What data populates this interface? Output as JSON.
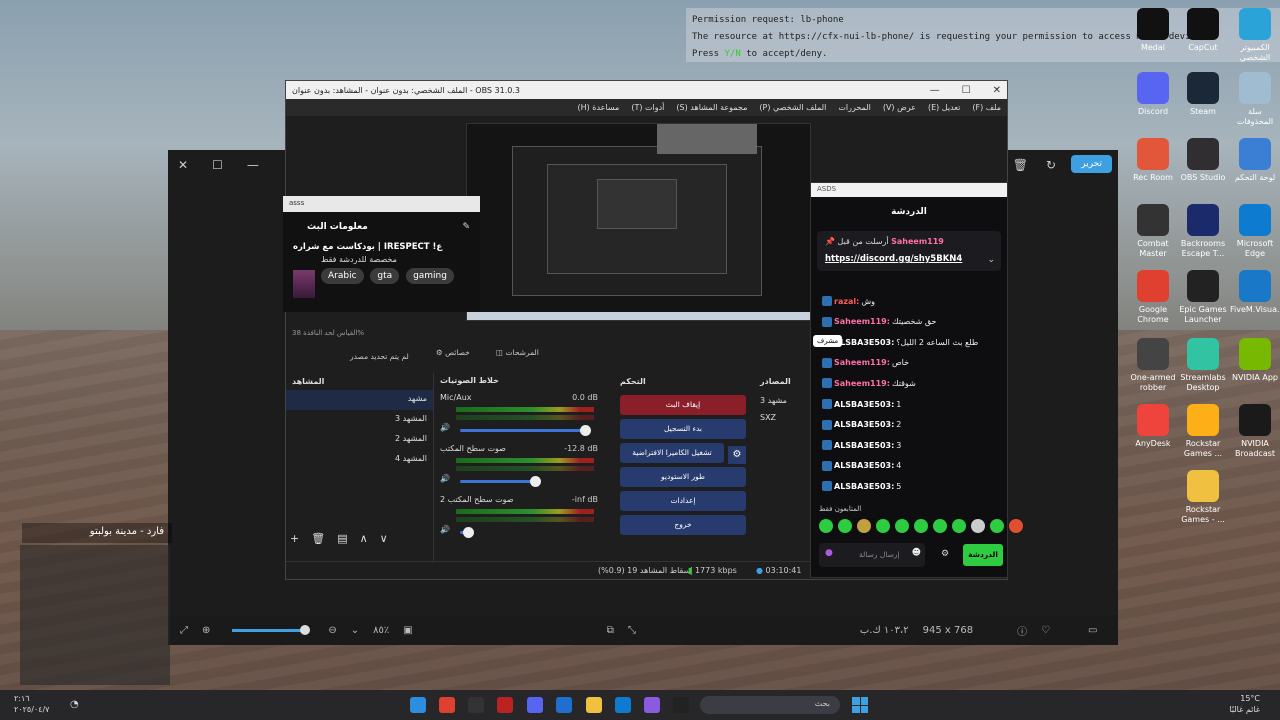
{
  "permission": {
    "line1": "Permission request: lb-phone",
    "line2": "The resource at https://cfx-nui-lb-phone/ is requesting your permission to access media devices.",
    "line3": "Press",
    "line3_key": "Y/N",
    "line3_rest": "to accept/deny."
  },
  "desktop_icons": [
    {
      "label": "Medal",
      "name": "medal-icon",
      "color": "#111111"
    },
    {
      "label": "CapCut",
      "name": "capcut-icon",
      "color": "#111111"
    },
    {
      "label": "الكمبيوتر الشخصي",
      "name": "this-pc-icon",
      "color": "#29a3d8"
    },
    {
      "label": "Discord",
      "name": "discord-icon",
      "color": "#5865f2"
    },
    {
      "label": "Steam",
      "name": "steam-icon",
      "color": "#1b2838"
    },
    {
      "label": "سلة المحذوفات",
      "name": "recycle-bin-icon",
      "color": "#9fbcd1"
    },
    {
      "label": "Rec Room",
      "name": "rec-room-icon",
      "color": "#e2573a"
    },
    {
      "label": "OBS Studio",
      "name": "obs-icon",
      "color": "#302e31"
    },
    {
      "label": "لوحة التحكم",
      "name": "control-panel-icon",
      "color": "#3a7fd4"
    },
    {
      "label": "Combat Master",
      "name": "combat-master-icon",
      "color": "#333333"
    },
    {
      "label": "Backrooms Escape T...",
      "name": "backrooms-icon",
      "color": "#1a2a6a"
    },
    {
      "label": "Microsoft Edge",
      "name": "edge-icon",
      "color": "#0c7bd0"
    },
    {
      "label": "Google Chrome",
      "name": "chrome-icon",
      "color": "#e0402f"
    },
    {
      "label": "Epic Games Launcher",
      "name": "epic-games-icon",
      "color": "#222222"
    },
    {
      "label": "FiveM.Visua...",
      "name": "fivem-visual-icon",
      "color": "#1a78c8"
    },
    {
      "label": "One-armed robber",
      "name": "one-armed-robber-icon",
      "color": "#444444"
    },
    {
      "label": "Streamlabs Desktop",
      "name": "streamlabs-icon",
      "color": "#31c3a2"
    },
    {
      "label": "NVIDIA App",
      "name": "nvidia-app-icon",
      "color": "#76b900"
    },
    {
      "label": "AnyDesk",
      "name": "anydesk-icon",
      "color": "#ef443b"
    },
    {
      "label": "Rockstar Games ...",
      "name": "rockstar-icon",
      "color": "#fcaf17"
    },
    {
      "label": "NVIDIA Broadcast",
      "name": "nvidia-broadcast-icon",
      "color": "#1a1a1a"
    },
    {
      "label": "Rockstar Games - ...",
      "name": "rockstar-folder-icon",
      "color": "#f0c040"
    }
  ],
  "photos": {
    "edit_label": "تحرير",
    "zoom": "٨٥٪",
    "dimensions": "945 x 768",
    "size": "١٠٣،٢ ك.ب"
  },
  "obs": {
    "title": "الملف الشخصي: بدون عنوان - المشاهد: بدون عنوان - OBS 31.0.3",
    "menu": [
      "ملف (F)",
      "تعديل (E)",
      "عرض (V)",
      "المحررات",
      "الملف الشخصي (P)",
      "مجموعة المشاهد (S)",
      "أدوات (T)",
      "مساعدة (H)"
    ],
    "stream_info": {
      "header": "asss",
      "title": "معلومات البث",
      "stream_title": "بودكاست مع شراره | IRESPECT !ع",
      "subtitle": "مخصصة للدردشة فقط",
      "tags": [
        "Arabic",
        "gta",
        "gaming"
      ]
    },
    "scale_label": "القياس لحد النافذة 38%",
    "no_source": "لم يتم تحديد مصدر",
    "props_label": "خصائص",
    "filters_label": "المرشحات",
    "scenes": {
      "title": "المشاهد",
      "items": [
        "مشهد",
        "المشهد 3",
        "المشهد 2",
        "المشهد 4"
      ]
    },
    "mixer": {
      "title": "خلاط الصوتيات",
      "channels": [
        {
          "name": "Mic/Aux",
          "db": "0.0 dB",
          "level": 0.92
        },
        {
          "name": "صوت سطح المكتب",
          "db": "-12.8 dB",
          "level": 0.55
        },
        {
          "name": "صوت سطح المكتب 2",
          "db": "-inf dB",
          "level": 0.05
        }
      ]
    },
    "controls": {
      "title": "التحكم",
      "buttons": [
        "إيقاف البث",
        "بدء التسجيل",
        "تشغيل الكاميرا الافتراضية",
        "طور الاستوديو",
        "إعدادات",
        "خروج"
      ]
    },
    "sources": {
      "title": "المصادر",
      "items": [
        "مشهد 3",
        "SXZ"
      ]
    },
    "status": {
      "dropped": "إسقاط المشاهد 19 (0.9%)",
      "bitrate": "1773 kbps",
      "time": "03:10:41"
    }
  },
  "chat": {
    "header": "ASDS",
    "title": "الدردشة",
    "pinned_label": "أرسلت من قبل",
    "pinned_user": "Saheem119",
    "pinned_link": "https://discord.gg/shy5BKN4",
    "messages": [
      {
        "user": "razal",
        "text": "وش",
        "color": "#ff5a5a"
      },
      {
        "user": "Saheem119",
        "text": "حق شخصيتك",
        "color": "#ff6fa8"
      },
      {
        "user": "ALSBA3E503",
        "text": "طلع بث الساعه 2 الليل؟",
        "color": "#ffffff"
      },
      {
        "user": "Saheem119",
        "text": "خاص",
        "color": "#ff6fa8"
      },
      {
        "user": "Saheem119",
        "text": "شوقتك",
        "color": "#ff6fa8"
      },
      {
        "user": "ALSBA3E503",
        "text": "1",
        "color": "#ffffff"
      },
      {
        "user": "ALSBA3E503",
        "text": "2",
        "color": "#ffffff"
      },
      {
        "user": "ALSBA3E503",
        "text": "3",
        "color": "#ffffff"
      },
      {
        "user": "ALSBA3E503",
        "text": "4",
        "color": "#ffffff"
      },
      {
        "user": "ALSBA3E503",
        "text": "5",
        "color": "#ffffff"
      }
    ],
    "top_chatters": "المتابعون فقط",
    "input_placeholder": "إرسال رسالة",
    "send_label": "الدردشة",
    "tooltip": "مشرف"
  },
  "game_hud": {
    "location": "فارد - مدينة بولبتو"
  },
  "taskbar": {
    "search": "بحث",
    "temp": "15°C",
    "weather": "غائم غالبًا",
    "time": "٢:١٦",
    "date": "٢٠٢٥/٠٤/٧"
  }
}
